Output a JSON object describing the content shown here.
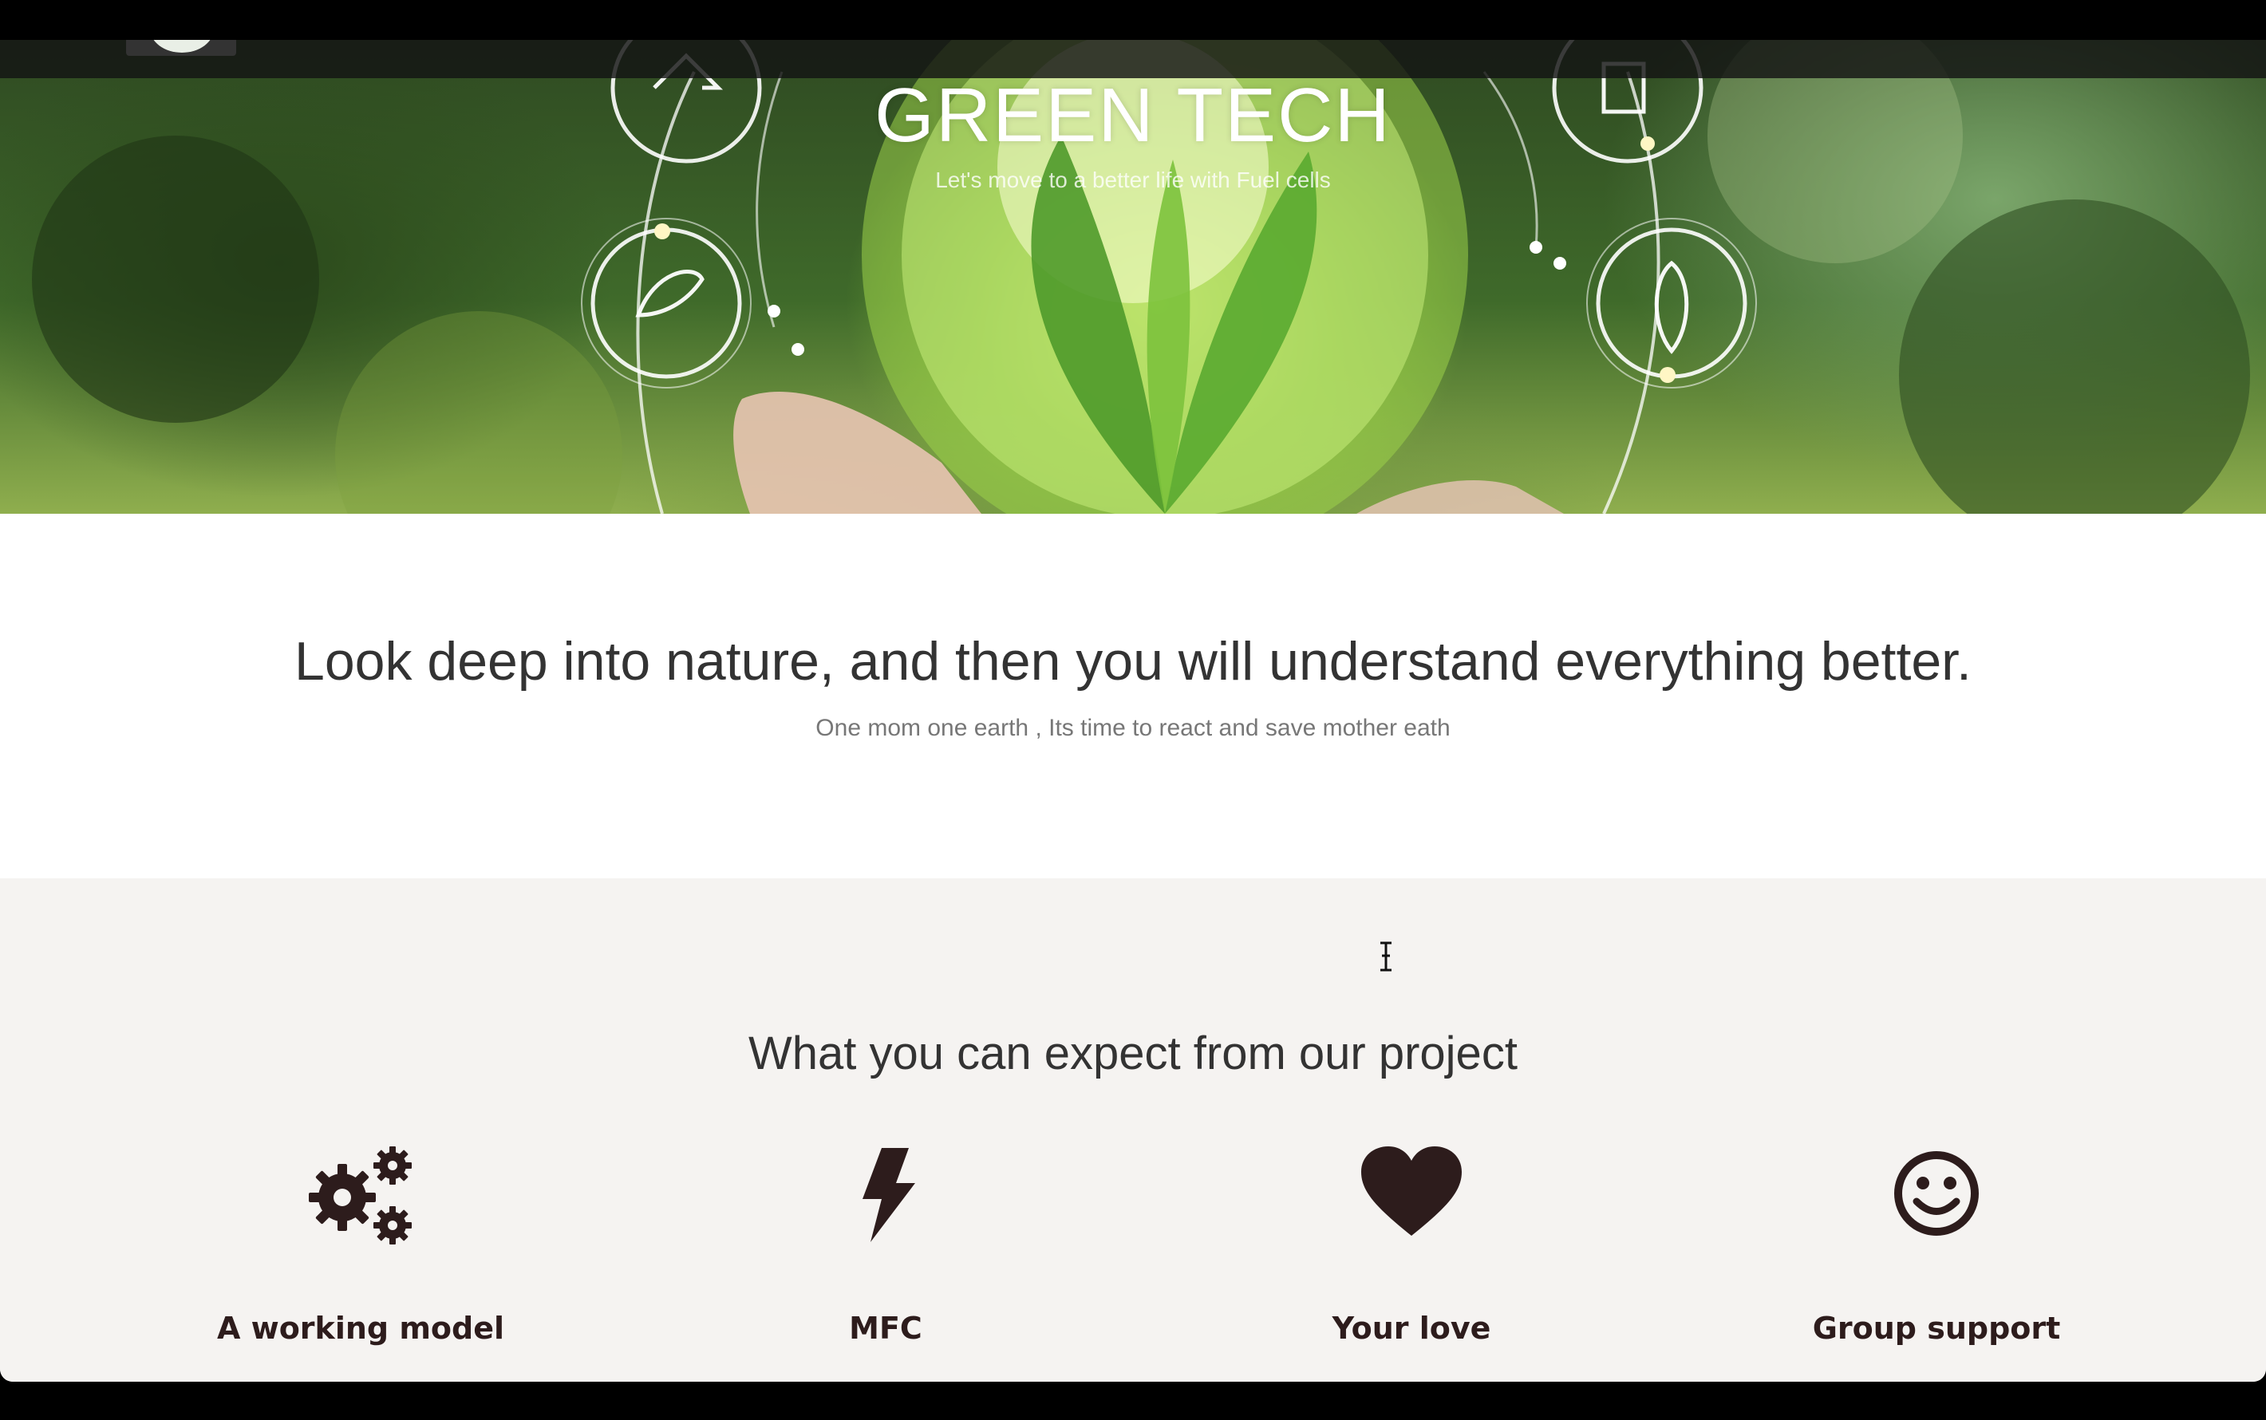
{
  "hero": {
    "title": "GREEN TECH",
    "subtitle": "Let's move to a better life with Fuel cells"
  },
  "quote": {
    "text": "Look deep into nature, and then you will understand everything better.",
    "subtext": "One mom one earth , Its time to react and save mother eath"
  },
  "features": {
    "heading": "What you can expect from our project",
    "items": [
      {
        "label": "A working model",
        "icon": "gears-icon"
      },
      {
        "label": "MFC",
        "icon": "lightning-bolt-icon"
      },
      {
        "label": "Your love",
        "icon": "heart-icon"
      },
      {
        "label": "Group support",
        "icon": "smiley-icon"
      }
    ]
  },
  "colors": {
    "icon": "#2d1c1c",
    "features_bg": "#f5f3f1",
    "nav_bg": "#141414"
  }
}
